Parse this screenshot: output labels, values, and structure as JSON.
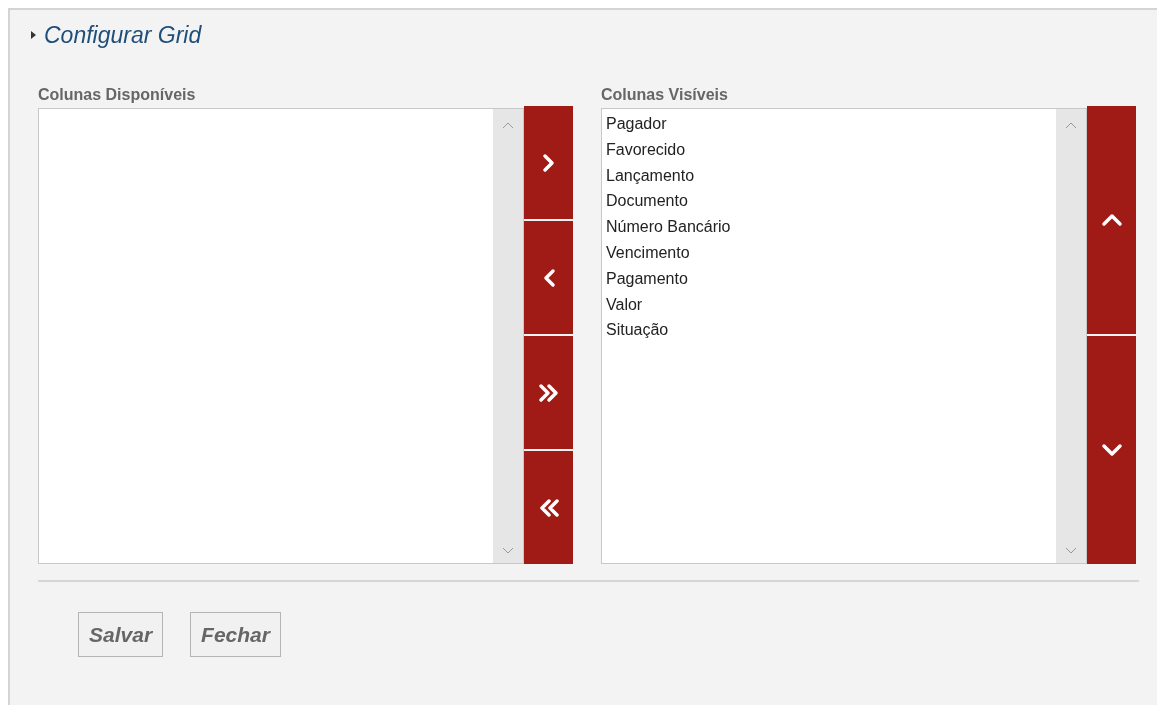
{
  "section": {
    "title": "Configurar Grid",
    "expanded": false
  },
  "available": {
    "label": "Colunas Disponíveis"
  },
  "transfer_buttons": [
    {
      "kind": "right"
    },
    {
      "kind": "left"
    },
    {
      "kind": "all_right"
    },
    {
      "kind": "all_left"
    }
  ],
  "visible": {
    "label": "Colunas Visíveis",
    "items": [
      "Pagador",
      "Favorecido",
      "Lançamento",
      "Documento",
      "Número Bancário",
      "Vencimento",
      "Pagamento",
      "Valor",
      "Situação"
    ]
  },
  "order_buttons": [
    {
      "kind": "up"
    },
    {
      "kind": "down"
    }
  ],
  "actions": [
    "Salvar",
    "Fechar"
  ]
}
